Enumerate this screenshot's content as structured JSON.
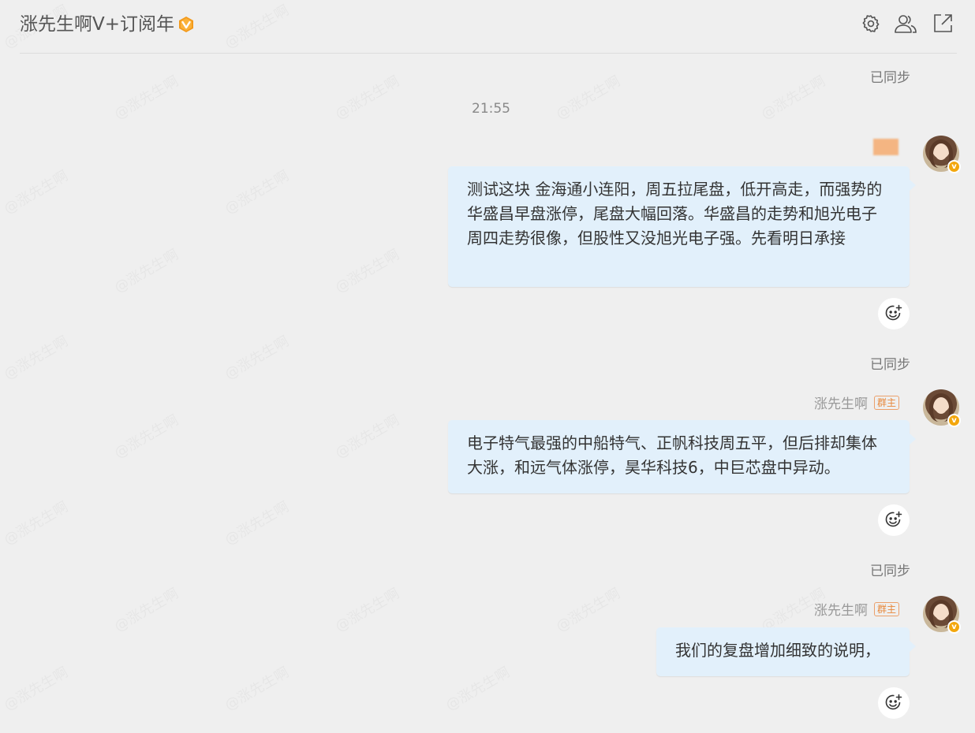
{
  "header": {
    "title": "涨先生啊V+订阅年",
    "badge_icon": "v-badge-icon",
    "actions": [
      {
        "name": "settings-icon"
      },
      {
        "name": "members-icon"
      },
      {
        "name": "open-external-icon"
      }
    ]
  },
  "colors": {
    "background": "#efefef",
    "bubble": "#e2f0fb",
    "role_badge": "#e7873a",
    "v_badge": "#f3a70d"
  },
  "watermark": "@涨先生啊",
  "timestamp": "21:55",
  "messages": [
    {
      "sync_status": "已同步",
      "sender": "",
      "role": "",
      "text": "测试这块 金海通小连阳，周五拉尾盘，低开高走，而强势的华盛昌早盘涨停，尾盘大幅回落。华盛昌的走势和旭光电子周四走势很像，但股性又没旭光电子强。先看明日承接"
    },
    {
      "sync_status": "已同步",
      "sender": "涨先生啊",
      "role": "群主",
      "text": "电子特气最强的中船特气、正帆科技周五平，但后排却集体大涨，和远气体涨停，昊华科技6，中巨芯盘中异动。"
    },
    {
      "sync_status": "已同步",
      "sender": "涨先生啊",
      "role": "群主",
      "text": "我们的复盘增加细致的说明，"
    }
  ]
}
